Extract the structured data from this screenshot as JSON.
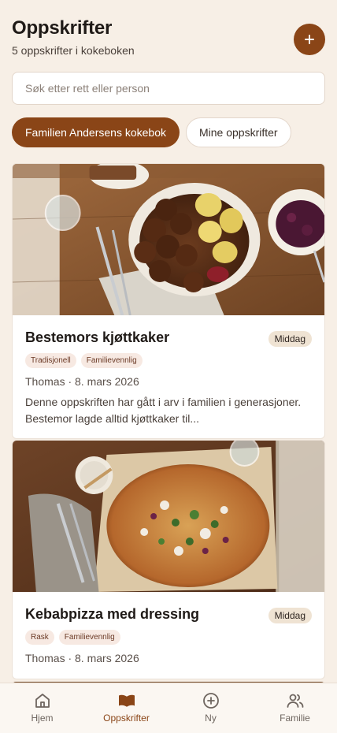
{
  "header": {
    "title": "Oppskrifter",
    "subtitle": "5 oppskrifter i kokeboken",
    "add_icon": "plus-icon"
  },
  "search": {
    "placeholder": "Søk etter rett eller person",
    "value": ""
  },
  "tabs": [
    {
      "label": "Familien Andersens kokebok",
      "active": true
    },
    {
      "label": "Mine oppskrifter",
      "active": false
    }
  ],
  "recipes": [
    {
      "title": "Bestemors kjøttkaker",
      "category": "Middag",
      "tags": [
        "Tradisjonell",
        "Familievennlig"
      ],
      "meta": "Thomas · 8. mars 2026",
      "excerpt": "Denne oppskriften har gått i arv i familien i generasjoner. Bestemor lagde alltid kjøttkaker til..."
    },
    {
      "title": "Kebabpizza med dressing",
      "category": "Middag",
      "tags": [
        "Rask",
        "Familievennlig"
      ],
      "meta": "Thomas · 8. mars 2026"
    }
  ],
  "bottom_nav": [
    {
      "label": "Hjem",
      "icon": "home-icon",
      "active": false
    },
    {
      "label": "Oppskrifter",
      "icon": "book-icon",
      "active": true
    },
    {
      "label": "Ny",
      "icon": "plus-circle-icon",
      "active": false
    },
    {
      "label": "Familie",
      "icon": "users-icon",
      "active": false
    }
  ],
  "colors": {
    "accent": "#8a4517",
    "background": "#f7efe6",
    "badge": "#efe3d3",
    "tag": "#f7e9e2"
  }
}
